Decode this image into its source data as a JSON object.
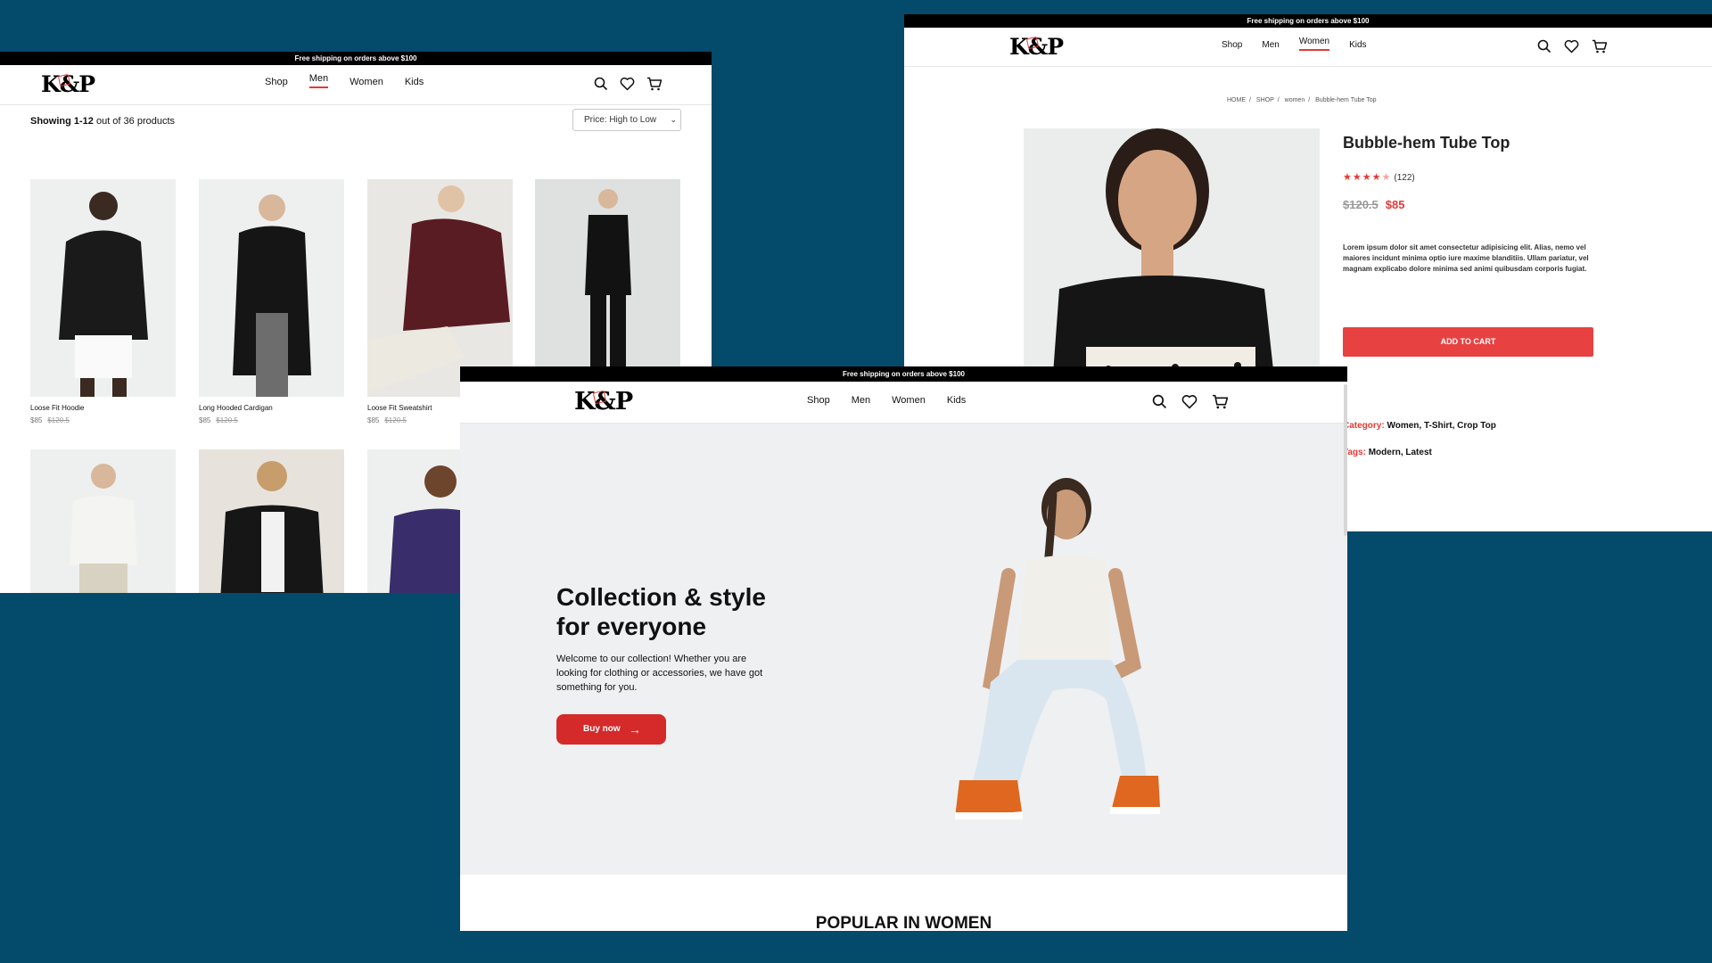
{
  "shipping_banner": "Free shipping on orders above $100",
  "brand": "K&P",
  "nav_links": [
    "Shop",
    "Men",
    "Women",
    "Kids"
  ],
  "listing": {
    "active_nav": "Men",
    "showing_bold": "Showing 1-12",
    "showing_rest": " out of 36 products",
    "sort_value": "Price: High to Low",
    "products": [
      {
        "name": "Loose Fit Hoodie",
        "price": "$85",
        "old_price": "$120.5",
        "top": "#1a1a1a",
        "bottom": "#ffffff"
      },
      {
        "name": "Long Hooded Cardigan",
        "price": "$85",
        "old_price": "$120.5",
        "top": "#151515",
        "bottom": "#6d6d6d"
      },
      {
        "name": "Loose Fit Sweatshirt",
        "price": "$85",
        "old_price": "$120.5",
        "top": "#5a1c23",
        "bottom": "#ece9e0"
      },
      {
        "name": "",
        "price": "",
        "old_price": "",
        "top": "#121212",
        "bottom": "#121212"
      },
      {
        "name": "",
        "price": "",
        "old_price": "",
        "top": "#f4f4f2",
        "bottom": "#d8d2c2"
      },
      {
        "name": "",
        "price": "",
        "old_price": "",
        "top": "#161616",
        "bottom": "#2a2a2a"
      },
      {
        "name": "",
        "price": "",
        "old_price": "",
        "top": "#3a2d6b",
        "bottom": "#3a2d6b"
      }
    ]
  },
  "product": {
    "active_nav": "Women",
    "breadcrumb": [
      "HOME",
      "SHOP",
      "women",
      "Bubble-hem Tube Top"
    ],
    "title": "Bubble-hem Tube Top",
    "rating": 4,
    "rating_count": "(122)",
    "old_price": "$120.5",
    "price": "$85",
    "description": "Lorem ipsum dolor sit amet consectetur adipisicing elit. Alias, nemo vel maiores incidunt minima optio iure maxime blanditiis. Ullam pariatur, vel magnam explicabo dolore minima sed animi quibusdam corporis fugiat.",
    "add_to_cart": "ADD TO CART",
    "category_label": "Category:",
    "category_value": "Women, T-Shirt, Crop Top",
    "tags_label": "Tags:",
    "tags_value": "Modern, Latest"
  },
  "home": {
    "hero_title_line1": "Collection & style",
    "hero_title_line2": "for everyone",
    "hero_text": "Welcome to our collection! Whether you are looking for clothing or accessories, we have got something for you.",
    "cta": "Buy now",
    "section_title": "POPULAR IN WOMEN"
  },
  "colors": {
    "background": "#034a6b",
    "accent": "#e53935",
    "button": "#d42a2a"
  }
}
